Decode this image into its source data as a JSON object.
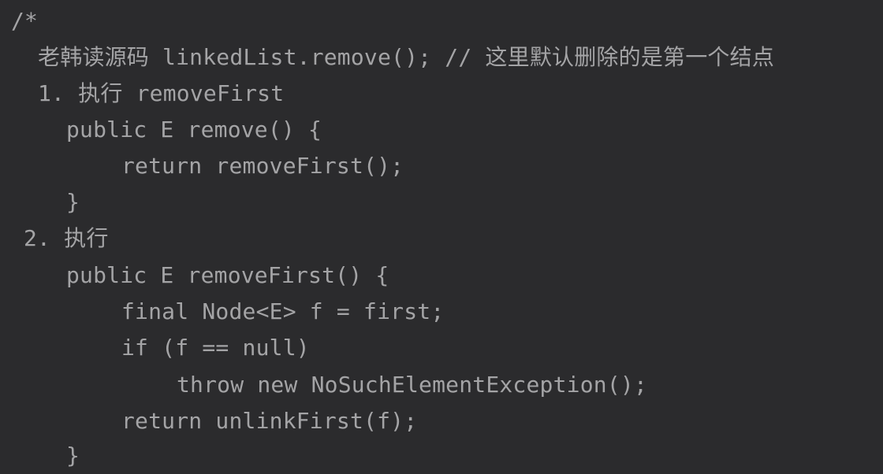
{
  "editor": {
    "text_color": "#a4a4a6",
    "background_color": "#2b2b2d",
    "lines": [
      "/*",
      "老韩读源码 linkedList.remove(); // 这里默认删除的是第一个结点",
      "1. 执行 removeFirst",
      "public E remove() {",
      "return removeFirst();",
      "}",
      "2. 执行",
      "public E removeFirst() {",
      "final Node<E> f = first;",
      "if (f == null)",
      "throw new NoSuchElementException();",
      "return unlinkFirst(f);",
      "}"
    ]
  }
}
